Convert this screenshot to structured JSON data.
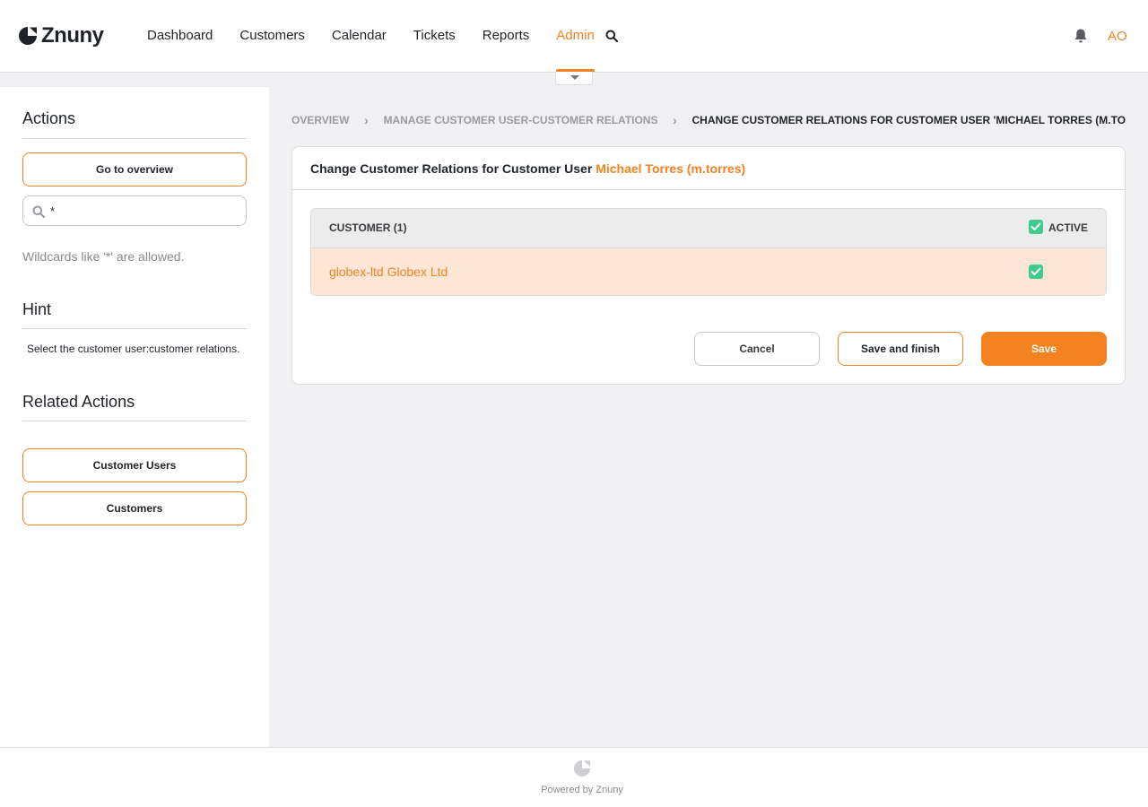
{
  "app": {
    "name": "Znuny"
  },
  "nav": {
    "items": [
      "Dashboard",
      "Customers",
      "Calendar",
      "Tickets",
      "Reports",
      "Admin"
    ],
    "active": "Admin",
    "user_initials": "AO"
  },
  "sidebar": {
    "actions_title": "Actions",
    "go_to_overview": "Go to overview",
    "filter_value": "*",
    "wildcard_hint": "Wildcards like '*' are allowed.",
    "hint_title": "Hint",
    "hint_text": "Select the customer user:customer relations.",
    "related_title": "Related Actions",
    "related_items": [
      "Customer Users",
      "Customers"
    ]
  },
  "breadcrumb": [
    "OVERVIEW",
    "MANAGE CUSTOMER USER-CUSTOMER RELATIONS",
    "CHANGE CUSTOMER RELATIONS FOR CUSTOMER USER 'MICHAEL TORRES (M.TO"
  ],
  "card": {
    "title_prefix": "Change Customer Relations for Customer User",
    "title_user": "Michael Torres (m.torres)",
    "table": {
      "col_customer": "CUSTOMER (1)",
      "col_active": "ACTIVE",
      "rows": [
        {
          "customer": "globex-ltd Globex Ltd",
          "active": true
        }
      ]
    },
    "buttons": {
      "cancel": "Cancel",
      "save_finish": "Save and finish",
      "save": "Save"
    }
  },
  "footer": {
    "text": "Powered by Znuny"
  },
  "colors": {
    "accent": "#f48221",
    "check": "#3dcc8e",
    "row_highlight": "#fde6d6"
  },
  "icons": [
    "znuny-logo-icon",
    "search-icon",
    "bell-icon",
    "chevron-down-icon",
    "chevron-right-icon",
    "checkbox-checked-icon"
  ]
}
